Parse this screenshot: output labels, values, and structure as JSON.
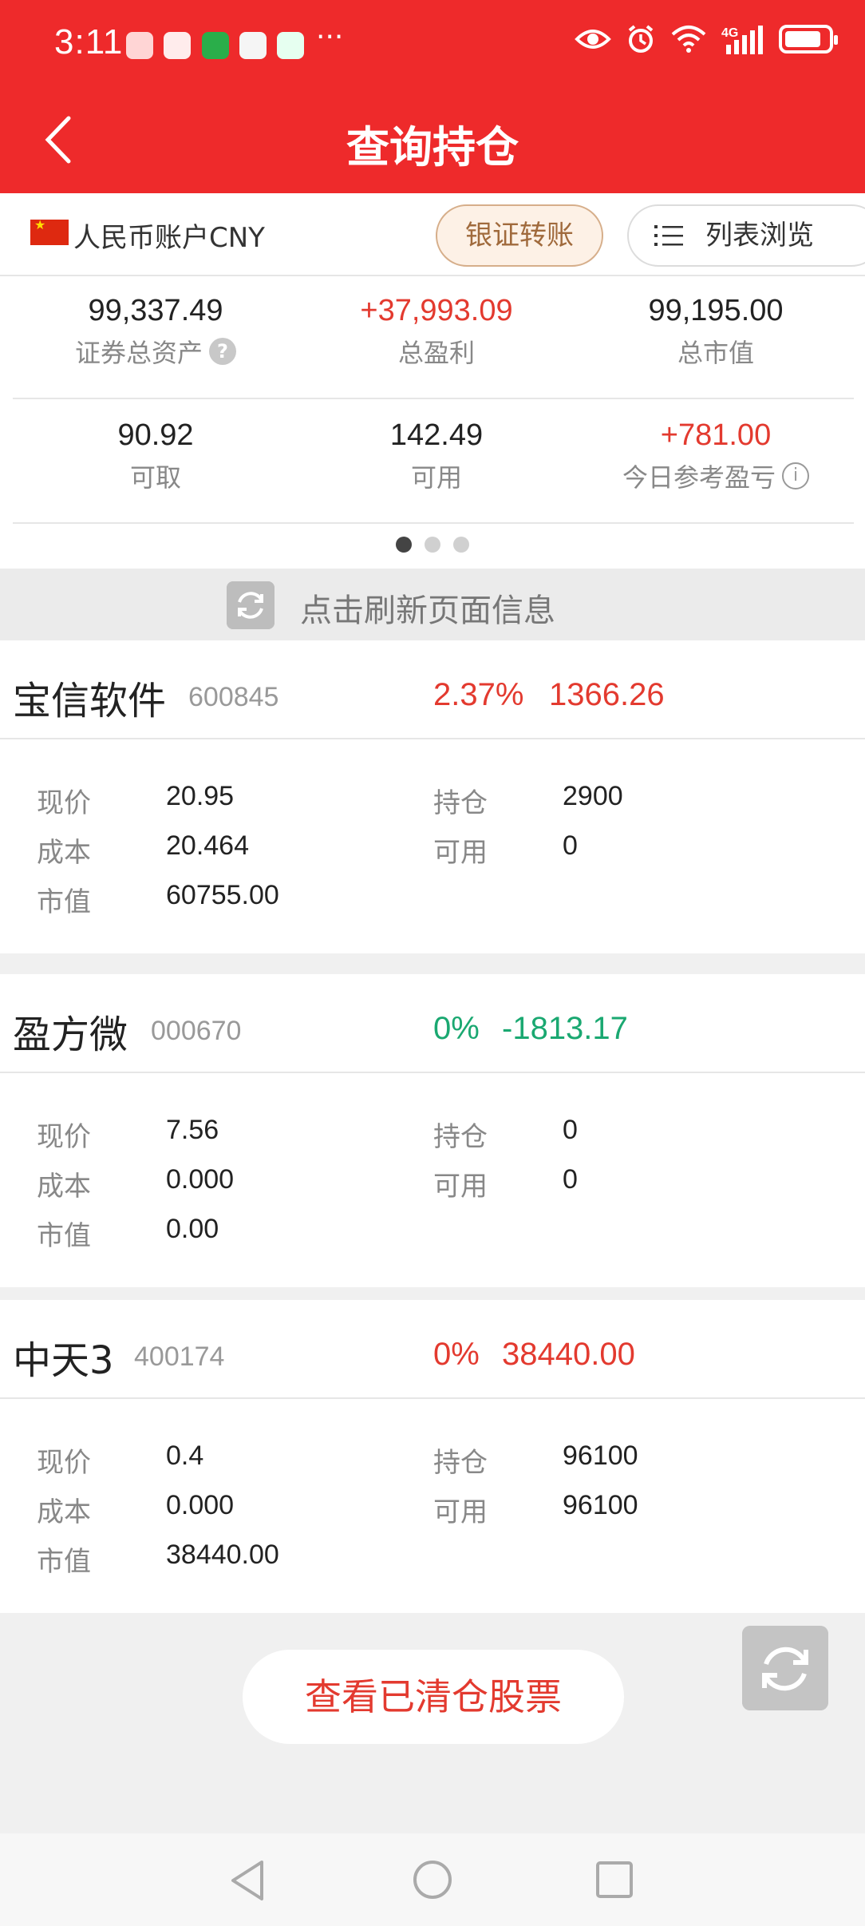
{
  "status_bar": {
    "time": "3:11",
    "more": "···",
    "signal": "4G"
  },
  "header": {
    "title": "查询持仓"
  },
  "account": {
    "label": "人民币账户CNY",
    "transfer_button": "银证转账",
    "list_button": "列表浏览"
  },
  "summary": {
    "total_assets": {
      "value": "99,337.49",
      "label": "证券总资产"
    },
    "total_profit": {
      "value": "+37,993.09",
      "label": "总盈利"
    },
    "market_value": {
      "value": "99,195.00",
      "label": "总市值"
    },
    "withdrawable": {
      "value": "90.92",
      "label": "可取"
    },
    "available": {
      "value": "142.49",
      "label": "可用"
    },
    "today_pnl": {
      "value": "+781.00",
      "label": "今日参考盈亏"
    },
    "help_glyph": "?",
    "info_glyph": "i"
  },
  "refresh_text": "点击刷新页面信息",
  "labels": {
    "price": "现价",
    "cost": "成本",
    "mv": "市值",
    "position": "持仓",
    "available": "可用"
  },
  "positions": [
    {
      "name": "宝信软件",
      "code": "600845",
      "pct": "2.37%",
      "pnl": "1366.26",
      "price": "20.95",
      "cost": "20.464",
      "mv": "60755.00",
      "position": "2900",
      "available": "0",
      "color": "#e33a2f"
    },
    {
      "name": "盈方微",
      "code": "000670",
      "pct": "0%",
      "pnl": "-1813.17",
      "price": "7.56",
      "cost": "0.000",
      "mv": "0.00",
      "position": "0",
      "available": "0",
      "color": "#1aa871"
    },
    {
      "name": "中天3",
      "code": "400174",
      "pct": "0%",
      "pnl": "38440.00",
      "price": "0.4",
      "cost": "0.000",
      "mv": "38440.00",
      "position": "96100",
      "available": "96100",
      "color": "#e33a2f"
    }
  ],
  "cleared_button": "查看已清仓股票",
  "colors": {
    "brand": "#ee2a2b",
    "up": "#e33a2f",
    "down": "#1aa871"
  }
}
